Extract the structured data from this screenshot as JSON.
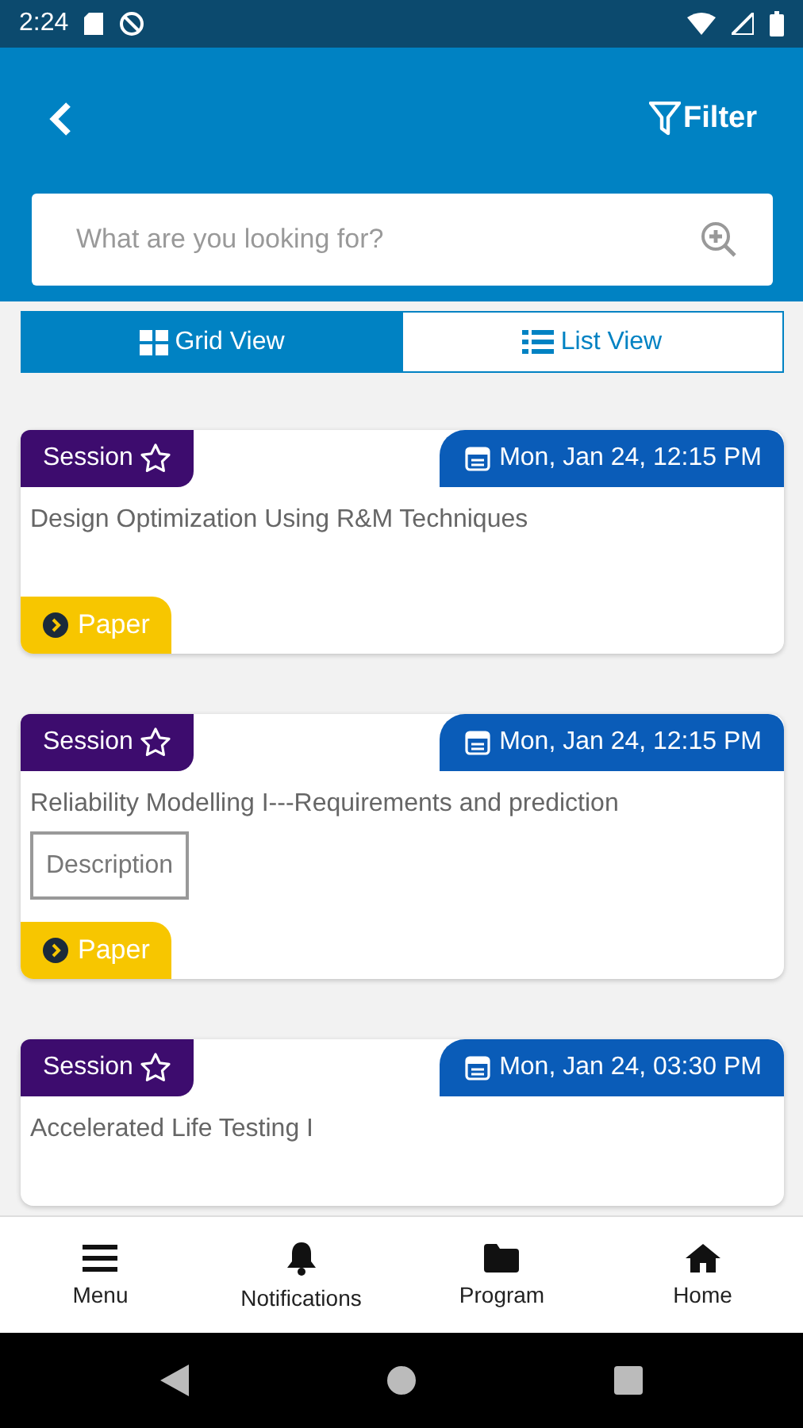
{
  "status_bar": {
    "time": "2:24"
  },
  "header": {
    "filter_label": "Filter"
  },
  "search": {
    "placeholder": "What are you looking for?"
  },
  "view_tabs": [
    {
      "label": "Grid View",
      "kind": "grid",
      "selected": true
    },
    {
      "label": "List View",
      "kind": "list",
      "selected": false
    }
  ],
  "sessions": [
    {
      "type": "Session",
      "date": "Mon, Jan 24, 12:15 PM",
      "title": "Design Optimization Using R&M Techniques",
      "tag": "Paper"
    },
    {
      "type": "Session",
      "date": "Mon, Jan 24, 12:15 PM",
      "title": "Reliability Modelling I---Requirements and prediction",
      "description": "Description",
      "tag": "Paper"
    },
    {
      "type": "Session",
      "date": "Mon, Jan 24, 03:30 PM",
      "title": "Accelerated Life Testing I"
    }
  ],
  "bottom_nav": [
    {
      "label": "Menu",
      "kind": "menu"
    },
    {
      "label": "Notifications",
      "kind": "bell"
    },
    {
      "label": "Program",
      "kind": "folder"
    },
    {
      "label": "Home",
      "kind": "home"
    }
  ]
}
